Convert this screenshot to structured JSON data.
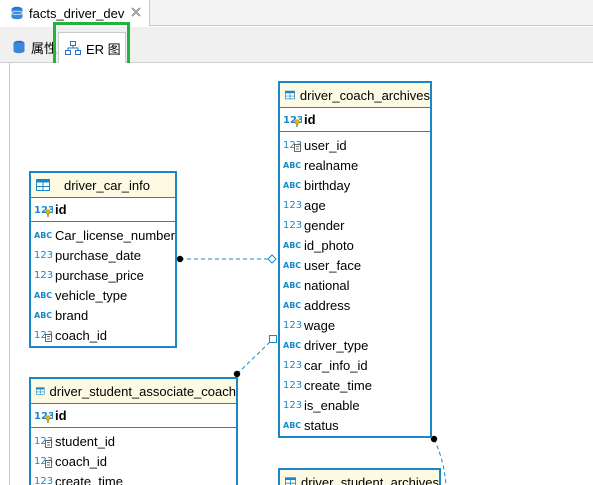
{
  "editor_tab": {
    "title": "facts_driver_dev"
  },
  "subtabs": {
    "properties": "属性",
    "er": "ER 图"
  },
  "entities": {
    "coach_archives": {
      "name": "driver_coach_archives",
      "pk": "id",
      "columns": [
        {
          "name": "user_id",
          "type": "fk-num"
        },
        {
          "name": "realname",
          "type": "text"
        },
        {
          "name": "birthday",
          "type": "text"
        },
        {
          "name": "age",
          "type": "num"
        },
        {
          "name": "gender",
          "type": "num"
        },
        {
          "name": "id_photo",
          "type": "text"
        },
        {
          "name": "user_face",
          "type": "text"
        },
        {
          "name": "national",
          "type": "text"
        },
        {
          "name": "address",
          "type": "text"
        },
        {
          "name": "wage",
          "type": "num"
        },
        {
          "name": "driver_type",
          "type": "text"
        },
        {
          "name": "car_info_id",
          "type": "num"
        },
        {
          "name": "create_time",
          "type": "num"
        },
        {
          "name": "is_enable",
          "type": "num"
        },
        {
          "name": "status",
          "type": "text"
        }
      ]
    },
    "car_info": {
      "name": "driver_car_info",
      "pk": "id",
      "columns": [
        {
          "name": "Car_license_number",
          "type": "text"
        },
        {
          "name": "purchase_date",
          "type": "num"
        },
        {
          "name": "purchase_price",
          "type": "num"
        },
        {
          "name": "vehicle_type",
          "type": "text"
        },
        {
          "name": "brand",
          "type": "text"
        },
        {
          "name": "coach_id",
          "type": "fk-num"
        }
      ]
    },
    "student_associate_coach": {
      "name": "driver_student_associate_coach",
      "pk": "id",
      "columns": [
        {
          "name": "student_id",
          "type": "fk-num"
        },
        {
          "name": "coach_id",
          "type": "fk-num"
        },
        {
          "name": "create_time",
          "type": "num"
        }
      ]
    },
    "student_archives": {
      "name": "driver_student_archives",
      "pk": "",
      "columns": []
    }
  },
  "colors": {
    "entity_border": "#1a88c6",
    "entity_header_bg": "#fcfae3",
    "type_icon": "#1a88c6",
    "highlight": "#22b33c"
  }
}
